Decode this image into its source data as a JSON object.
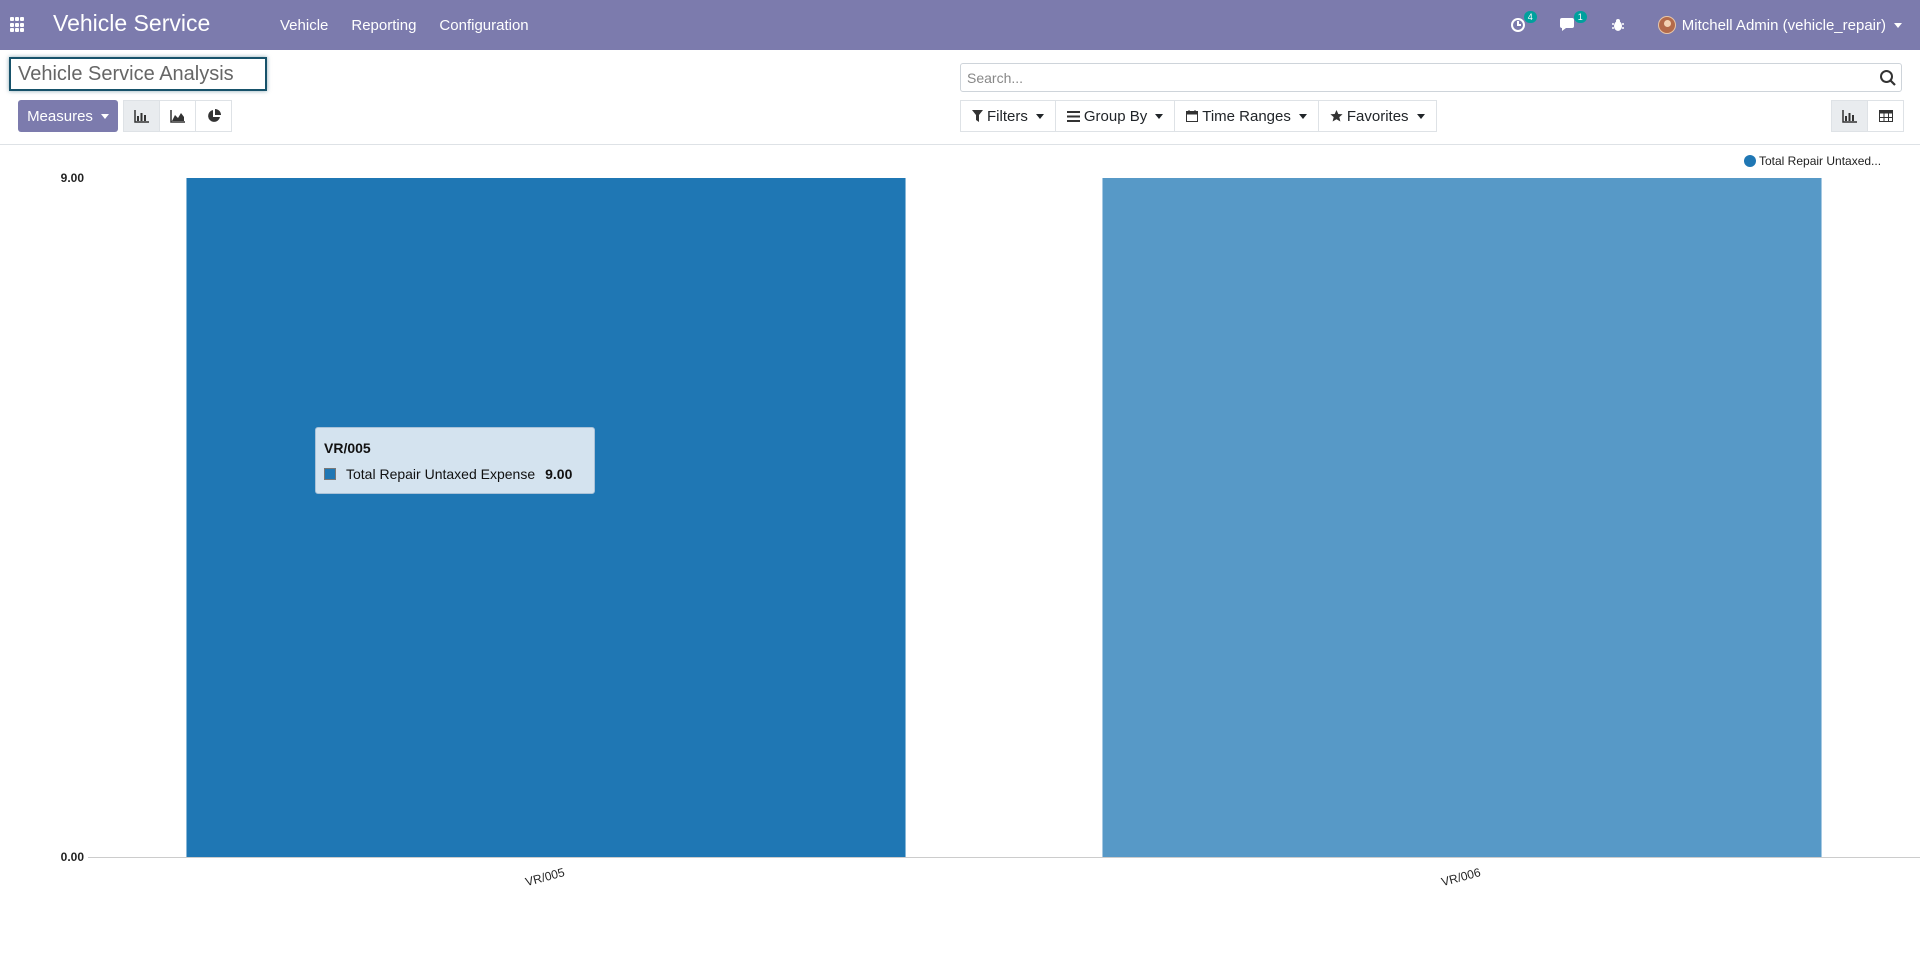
{
  "navbar": {
    "brand": "Vehicle Service",
    "menu": [
      "Vehicle",
      "Reporting",
      "Configuration"
    ],
    "activities_count": "4",
    "messages_count": "1",
    "user": "Mitchell Admin (vehicle_repair)"
  },
  "control": {
    "breadcrumb": "Vehicle Service Analysis",
    "search_placeholder": "Search...",
    "measures_label": "Measures",
    "filters_label": "Filters",
    "groupby_label": "Group By",
    "timeranges_label": "Time Ranges",
    "favorites_label": "Favorites"
  },
  "tooltip": {
    "title": "VR/005",
    "series": "Total Repair Untaxed Expense",
    "value": "9.00"
  },
  "chart_data": {
    "type": "bar",
    "categories": [
      "VR/005",
      "VR/006"
    ],
    "series": [
      {
        "name": "Total Repair Untaxed...",
        "values": [
          9.0,
          9.0
        ]
      }
    ],
    "colors": [
      "#1f77b4",
      "#5799c7"
    ],
    "y_ticks": [
      "0.00",
      "9.00"
    ],
    "ylim": [
      0,
      9
    ],
    "legend": "top-right",
    "grid": false
  }
}
